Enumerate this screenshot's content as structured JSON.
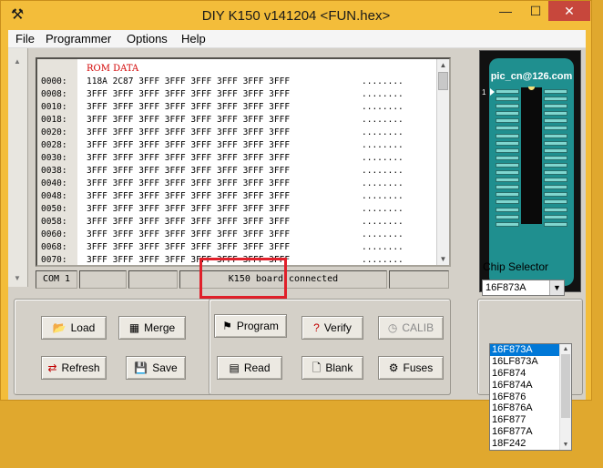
{
  "window": {
    "title": "DIY K150 v141204  <FUN.hex>",
    "app_icon": "programmer-icon",
    "controls": {
      "minimize": "—",
      "maximize": "☐",
      "close": "✕"
    }
  },
  "menu": [
    "File",
    "Programmer",
    "Options",
    "Help"
  ],
  "rom": {
    "heading": "ROM DATA",
    "rows": [
      {
        "addr": "0000:",
        "words": "118A 2C87 3FFF 3FFF 3FFF 3FFF 3FFF 3FFF",
        "ascii": "........"
      },
      {
        "addr": "0008:",
        "words": "3FFF 3FFF 3FFF 3FFF 3FFF 3FFF 3FFF 3FFF",
        "ascii": "........"
      },
      {
        "addr": "0010:",
        "words": "3FFF 3FFF 3FFF 3FFF 3FFF 3FFF 3FFF 3FFF",
        "ascii": "........"
      },
      {
        "addr": "0018:",
        "words": "3FFF 3FFF 3FFF 3FFF 3FFF 3FFF 3FFF 3FFF",
        "ascii": "........"
      },
      {
        "addr": "0020:",
        "words": "3FFF 3FFF 3FFF 3FFF 3FFF 3FFF 3FFF 3FFF",
        "ascii": "........"
      },
      {
        "addr": "0028:",
        "words": "3FFF 3FFF 3FFF 3FFF 3FFF 3FFF 3FFF 3FFF",
        "ascii": "........"
      },
      {
        "addr": "0030:",
        "words": "3FFF 3FFF 3FFF 3FFF 3FFF 3FFF 3FFF 3FFF",
        "ascii": "........"
      },
      {
        "addr": "0038:",
        "words": "3FFF 3FFF 3FFF 3FFF 3FFF 3FFF 3FFF 3FFF",
        "ascii": "........"
      },
      {
        "addr": "0040:",
        "words": "3FFF 3FFF 3FFF 3FFF 3FFF 3FFF 3FFF 3FFF",
        "ascii": "........"
      },
      {
        "addr": "0048:",
        "words": "3FFF 3FFF 3FFF 3FFF 3FFF 3FFF 3FFF 3FFF",
        "ascii": "........"
      },
      {
        "addr": "0050:",
        "words": "3FFF 3FFF 3FFF 3FFF 3FFF 3FFF 3FFF 3FFF",
        "ascii": "........"
      },
      {
        "addr": "0058:",
        "words": "3FFF 3FFF 3FFF 3FFF 3FFF 3FFF 3FFF 3FFF",
        "ascii": "........"
      },
      {
        "addr": "0060:",
        "words": "3FFF 3FFF 3FFF 3FFF 3FFF 3FFF 3FFF 3FFF",
        "ascii": "........"
      },
      {
        "addr": "0068:",
        "words": "3FFF 3FFF 3FFF 3FFF 3FFF 3FFF 3FFF 3FFF",
        "ascii": "........"
      },
      {
        "addr": "0070:",
        "words": "3FFF 3FFF 3FFF 3FFF 3FFF 3FFF 3FFF 3FFF",
        "ascii": "........"
      }
    ]
  },
  "status": {
    "port": "COM 1",
    "message": "K150 board connected"
  },
  "chip_view": {
    "brand": "pic_cn@126.com",
    "pin1_label": "1",
    "pin_rows": 19
  },
  "buttons": {
    "load": "Load",
    "merge": "Merge",
    "program": "Program",
    "verify": "Verify",
    "calib": "CALIB",
    "refresh": "Refresh",
    "save": "Save",
    "read": "Read",
    "blank": "Blank",
    "fuses": "Fuses"
  },
  "chip_selector": {
    "label": "Chip Selector",
    "selected": "16F873A",
    "options": [
      "16F873A",
      "16LF873A",
      "16F874",
      "16F874A",
      "16F876",
      "16F876A",
      "16F877",
      "16F877A",
      "18F242"
    ]
  },
  "colors": {
    "desktop": "#e0a82e",
    "highlight": "#e0202a",
    "rom_heading": "#d20000",
    "chip_board": "#1f8f8f",
    "selection": "#0078d7"
  }
}
